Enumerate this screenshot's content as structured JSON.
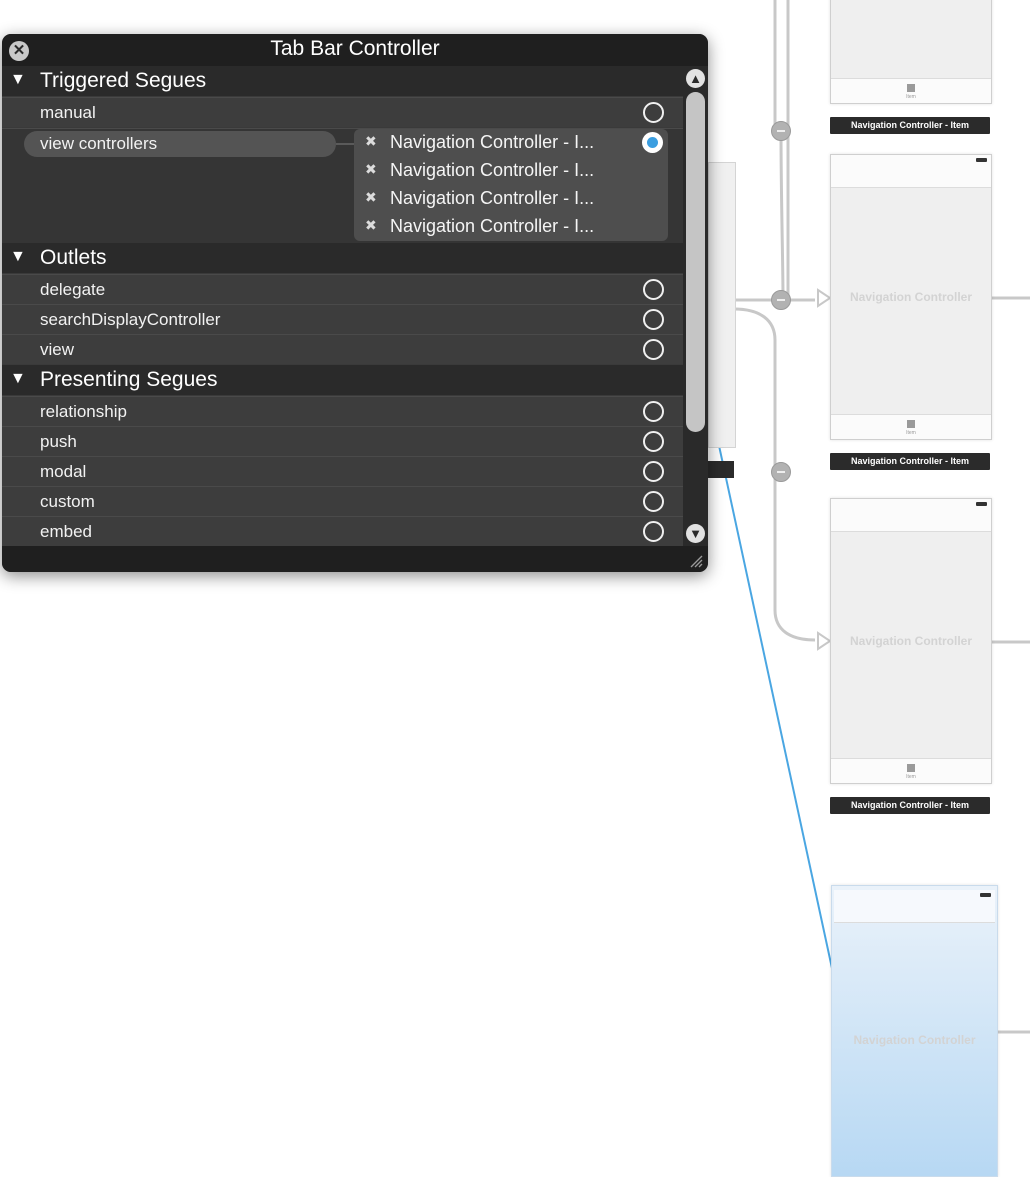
{
  "panel": {
    "title": "Tab Bar Controller",
    "sections": [
      {
        "label": "Triggered Segues"
      },
      {
        "label": "Outlets"
      },
      {
        "label": "Presenting Segues"
      }
    ],
    "triggered_segues": {
      "manual": "manual",
      "view_controllers": "view controllers",
      "connections": [
        "Navigation Controller - I...",
        "Navigation Controller - I...",
        "Navigation Controller - I...",
        "Navigation Controller - I..."
      ]
    },
    "outlets": [
      "delegate",
      "searchDisplayController",
      "view"
    ],
    "presenting_segues": [
      "relationship",
      "push",
      "modal",
      "custom",
      "embed"
    ]
  },
  "canvas": {
    "scene_label": "Navigation Controller",
    "scene_caption": "Navigation Controller - Item",
    "tab_item_label": "Item"
  },
  "colors": {
    "panel_bg": "#3a3a3a",
    "accent": "#3b9ee0"
  }
}
